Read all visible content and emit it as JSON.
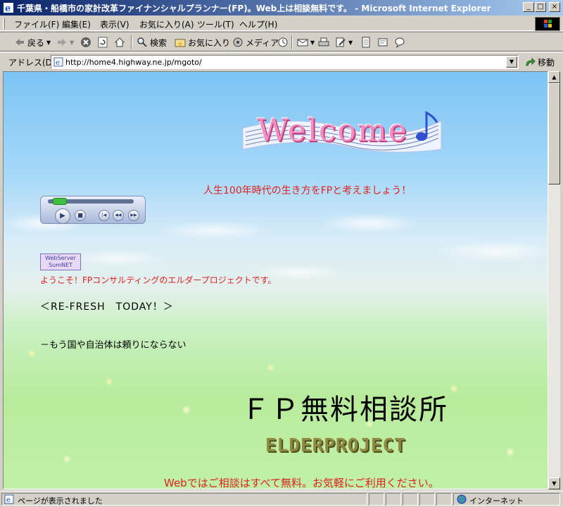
{
  "window": {
    "title": "千葉県・船橋市の家計改革ファイナンシャルプランナー(FP)。Web上は相談無料です。 - Microsoft Internet Explorer",
    "minimize": "_",
    "maximize": "□",
    "close": "×"
  },
  "menu": {
    "file": "ファイル(F)",
    "edit": "編集(E)",
    "view": "表示(V)",
    "favorites": "お気に入り(A)",
    "tools": "ツール(T)",
    "help": "ヘルプ(H)"
  },
  "toolbar": {
    "back": "戻る",
    "search": "検索",
    "favorites": "お気に入り",
    "media": "メディア"
  },
  "address": {
    "label": "アドレス(D)",
    "url": "http://home4.highway.ne.jp/mgoto/",
    "go": "移動"
  },
  "page": {
    "welcome_banner": "Welcome",
    "tagline": "人生100年時代の生き方をFPと考えましょう！",
    "webserver_badge_line1": "WebServer",
    "webserver_badge_line2": "SumNET",
    "intro": "ようこそ！FPコンサルティングのエルダープロジェクトです。",
    "refresh": "＜RE-FRESH　TODAY！＞",
    "marquee": "－もう国や自治体は頼りにならない",
    "heading": "ＦＰ無料相談所",
    "logo_text": "ELDERPROJECT",
    "free_notice": "Webではご相談はすべて無料。お気軽にご利用ください。"
  },
  "media_player": {
    "progress": 0.05,
    "play": "▶",
    "stop": "■",
    "prev": "|◀",
    "rew": "◀◀",
    "ffw": "▶▶"
  },
  "status": {
    "text": "ページが表示されました",
    "zone": "インターネット"
  },
  "colors": {
    "accent_red": "#e02020",
    "titlebar": "#0a246a"
  }
}
